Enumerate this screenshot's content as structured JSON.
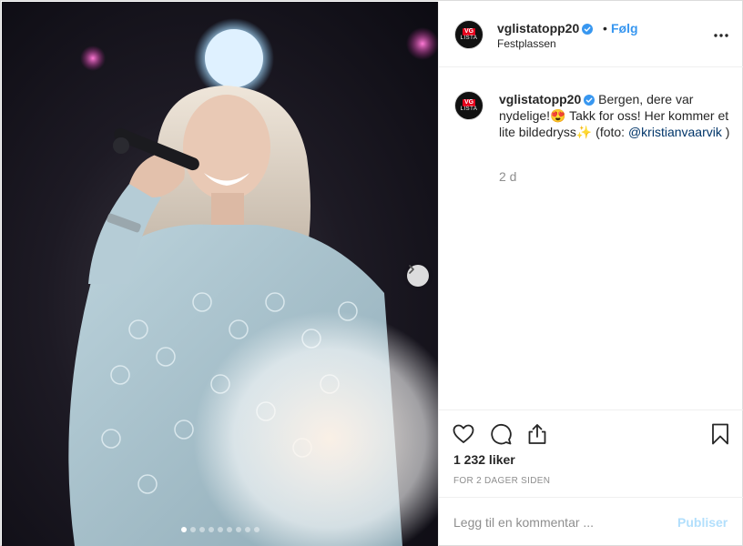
{
  "post": {
    "photo": {
      "carousel_count": 9,
      "carousel_active_index": 0
    },
    "header": {
      "username": "vglistatopp20",
      "separator": "•",
      "follow_label": "Følg",
      "location": "Festplassen",
      "avatar_logo": "VG",
      "avatar_sub": "LISTA"
    },
    "caption": {
      "username": "vglistatopp20",
      "text_part1": "Bergen, dere var nydelige!",
      "emoji1": "😍",
      "text_part2": " Takk for oss! Her kommer et lite bildedryss",
      "emoji2": "✨",
      "text_part3": " (foto: ",
      "mention": "@kristianvaarvik",
      "text_part4": " )",
      "time": "2 d"
    },
    "actions": {
      "likes": "1 232 liker",
      "ago": "FOR 2 DAGER SIDEN"
    },
    "comment": {
      "placeholder": "Legg til en kommentar ...",
      "publish_label": "Publiser"
    },
    "colors": {
      "accent": "#3897f0",
      "verified": "#3897f0",
      "publish_disabled": "#b2dffc",
      "mention": "#003569"
    },
    "icons": [
      "chevron-right-icon",
      "verified-icon",
      "more-icon",
      "heart-icon",
      "comment-icon",
      "share-icon",
      "bookmark-icon"
    ]
  }
}
